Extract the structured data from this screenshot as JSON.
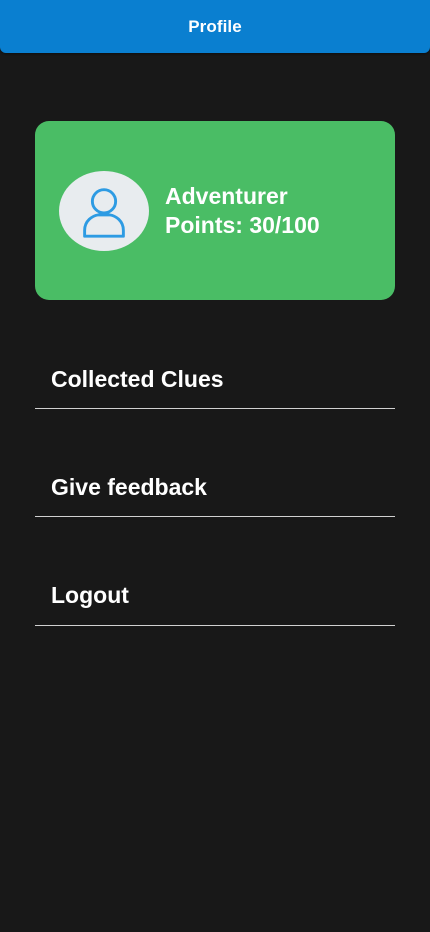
{
  "header": {
    "title": "Profile"
  },
  "profile_card": {
    "avatar_icon": "user-icon",
    "username": "Adventurer",
    "points": "Points: 30/100"
  },
  "menu": {
    "items": [
      {
        "label": "Collected Clues"
      },
      {
        "label": "Give feedback"
      },
      {
        "label": "Logout"
      }
    ]
  },
  "colors": {
    "background": "#181818",
    "header": "#0a7fd0",
    "card": "#4abd65",
    "avatar_bg": "#e8ecef",
    "avatar_icon": "#2d9be3",
    "divider": "#d0d0d0"
  }
}
